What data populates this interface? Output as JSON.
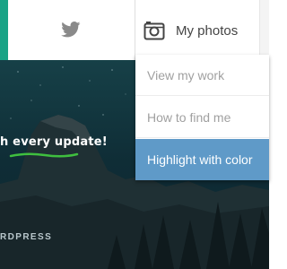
{
  "nav": {
    "twitter_icon": "twitter-bird-icon",
    "photos_icon": "camera-icon",
    "photos_label": "My photos"
  },
  "dropdown": {
    "items": [
      {
        "label": "View my work"
      },
      {
        "label": "How to find me"
      },
      {
        "label": "Highlight with color"
      }
    ],
    "active_index": 2
  },
  "hero": {
    "tagline": "h every update!",
    "brand": "RDPRESS"
  },
  "colors": {
    "accent": "#1aa386",
    "highlight": "#5f9ac8",
    "underline": "#3fbf3f"
  }
}
